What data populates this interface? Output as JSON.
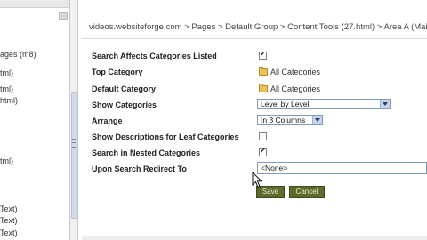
{
  "tree": {
    "items": [
      {
        "label": "ages (m8)"
      },
      {
        "label": "tml)"
      },
      {
        "label": "tml)"
      },
      {
        "label": "html)"
      },
      {
        "label": "tml)"
      },
      {
        "label": "Text)"
      },
      {
        "label": "Text)"
      },
      {
        "label": "Text)"
      }
    ]
  },
  "breadcrumb": "videos.websiteforge.com > Pages > Default Group > Content Tools (27.html) > Area A (Main)",
  "form": {
    "search_affects": {
      "label": "Search Affects Categories Listed",
      "checked": true
    },
    "top_category": {
      "label": "Top Category",
      "value": "All Categories"
    },
    "default_category": {
      "label": "Default Category",
      "value": "All Categories"
    },
    "show_categories": {
      "label": "Show Categories",
      "value": "Level by Level"
    },
    "arrange": {
      "label": "Arrange",
      "value": "In 3 Columns"
    },
    "show_descriptions": {
      "label": "Show Descriptions for Leaf Categories",
      "checked": false
    },
    "search_nested": {
      "label": "Search in Nested Categories",
      "checked": true
    },
    "redirect": {
      "label": "Upon Search Redirect To",
      "value": "<None>"
    }
  },
  "buttons": {
    "save": "Save",
    "cancel": "Cancel"
  },
  "icons": {
    "folder": "folder-icon",
    "checkmark": "checkmark-icon",
    "dropdown": "chevron-down-icon",
    "cursor": "mouse-pointer-icon"
  },
  "colors": {
    "button_bg": "#5c6a2c",
    "folder": "#e8c35a",
    "select_border": "#7f9db9"
  }
}
